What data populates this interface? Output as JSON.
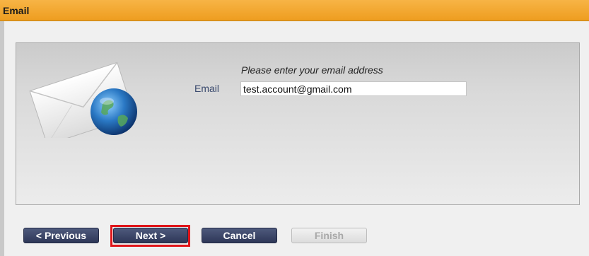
{
  "window": {
    "title": "Email"
  },
  "form": {
    "prompt": "Please enter your email address",
    "email_label": "Email",
    "email_value": "test.account@gmail.com"
  },
  "buttons": {
    "previous": "< Previous",
    "next": "Next >",
    "cancel": "Cancel",
    "finish": "Finish"
  },
  "icons": {
    "graphic": "email-envelope-globe-icon"
  },
  "colors": {
    "title_bar": "#f0a22c",
    "button_dark": "#3a4466",
    "highlight": "#e0151a"
  }
}
